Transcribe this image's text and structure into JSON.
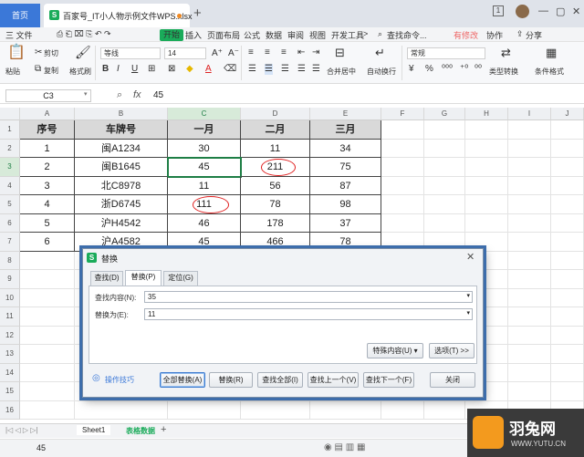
{
  "titlebar": {
    "home_tab": "首页",
    "doc_tab": "百家号_IT小人物示例文件WPS.xlsx",
    "doc_icon": "S",
    "new_tab": "+",
    "tab_count": "1"
  },
  "menubar": {
    "items": [
      "三 文件",
      "开始",
      "插入",
      "页面布局",
      "公式",
      "数据",
      "审阅",
      "视图",
      "开发工具"
    ],
    "more": ">",
    "search_placeholder": "查找命令...",
    "has_changes": "有修改",
    "collab": "协作",
    "share": "分享"
  },
  "ribbon": {
    "cut": "剪切",
    "copy": "复制",
    "paste": "粘贴",
    "format_painter": "格式刷",
    "font_name": "等线",
    "font_size": "14",
    "number_format": "常规",
    "merge_center": "合并居中",
    "wrap_text": "自动换行",
    "type_convert": "类型转换",
    "conditional_format": "条件格式"
  },
  "formula_bar": {
    "cell_ref": "C3",
    "fx": "fx",
    "value": "45"
  },
  "sheet": {
    "columns": [
      "A",
      "B",
      "C",
      "D",
      "E",
      "F",
      "G",
      "H",
      "I",
      "J"
    ],
    "rows": [
      "1",
      "2",
      "3",
      "4",
      "5",
      "6",
      "7",
      "8",
      "9",
      "10",
      "11",
      "12",
      "13",
      "14",
      "15",
      "16"
    ],
    "headers": [
      "序号",
      "车牌号",
      "一月",
      "二月",
      "三月"
    ],
    "data": [
      [
        "1",
        "闽A1234",
        "30",
        "11",
        "34"
      ],
      [
        "2",
        "闽B1645",
        "45",
        "211",
        "75"
      ],
      [
        "3",
        "北C8978",
        "11",
        "56",
        "87"
      ],
      [
        "4",
        "浙D6745",
        "111",
        "78",
        "98"
      ],
      [
        "5",
        "沪H4542",
        "46",
        "178",
        "37"
      ],
      [
        "6",
        "沪A4582",
        "45",
        "466",
        "78"
      ]
    ],
    "selected_cell": "C3"
  },
  "dialog": {
    "title": "替换",
    "icon": "S",
    "tabs": [
      "查找(D)",
      "替换(P)",
      "定位(G)"
    ],
    "active_tab": "替换(P)",
    "find_label": "查找内容(N):",
    "find_value": "35",
    "replace_label": "替换为(E):",
    "replace_value": "11",
    "special_button": "特殊内容(U) ▾",
    "options_button": "选项(T) >>",
    "tips_link": "操作技巧",
    "buttons": [
      "全部替换(A)",
      "替换(R)",
      "查找全部(I)",
      "查找上一个(V)",
      "查找下一个(F)",
      "关闭"
    ]
  },
  "sheet_tabs": {
    "tabs": [
      "Sheet1",
      "表格数据"
    ],
    "add": "+"
  },
  "statusbar": {
    "value": "45"
  },
  "watermark": {
    "text_cn": "羽兔网",
    "text_url": "WWW.YUTU.CN"
  }
}
